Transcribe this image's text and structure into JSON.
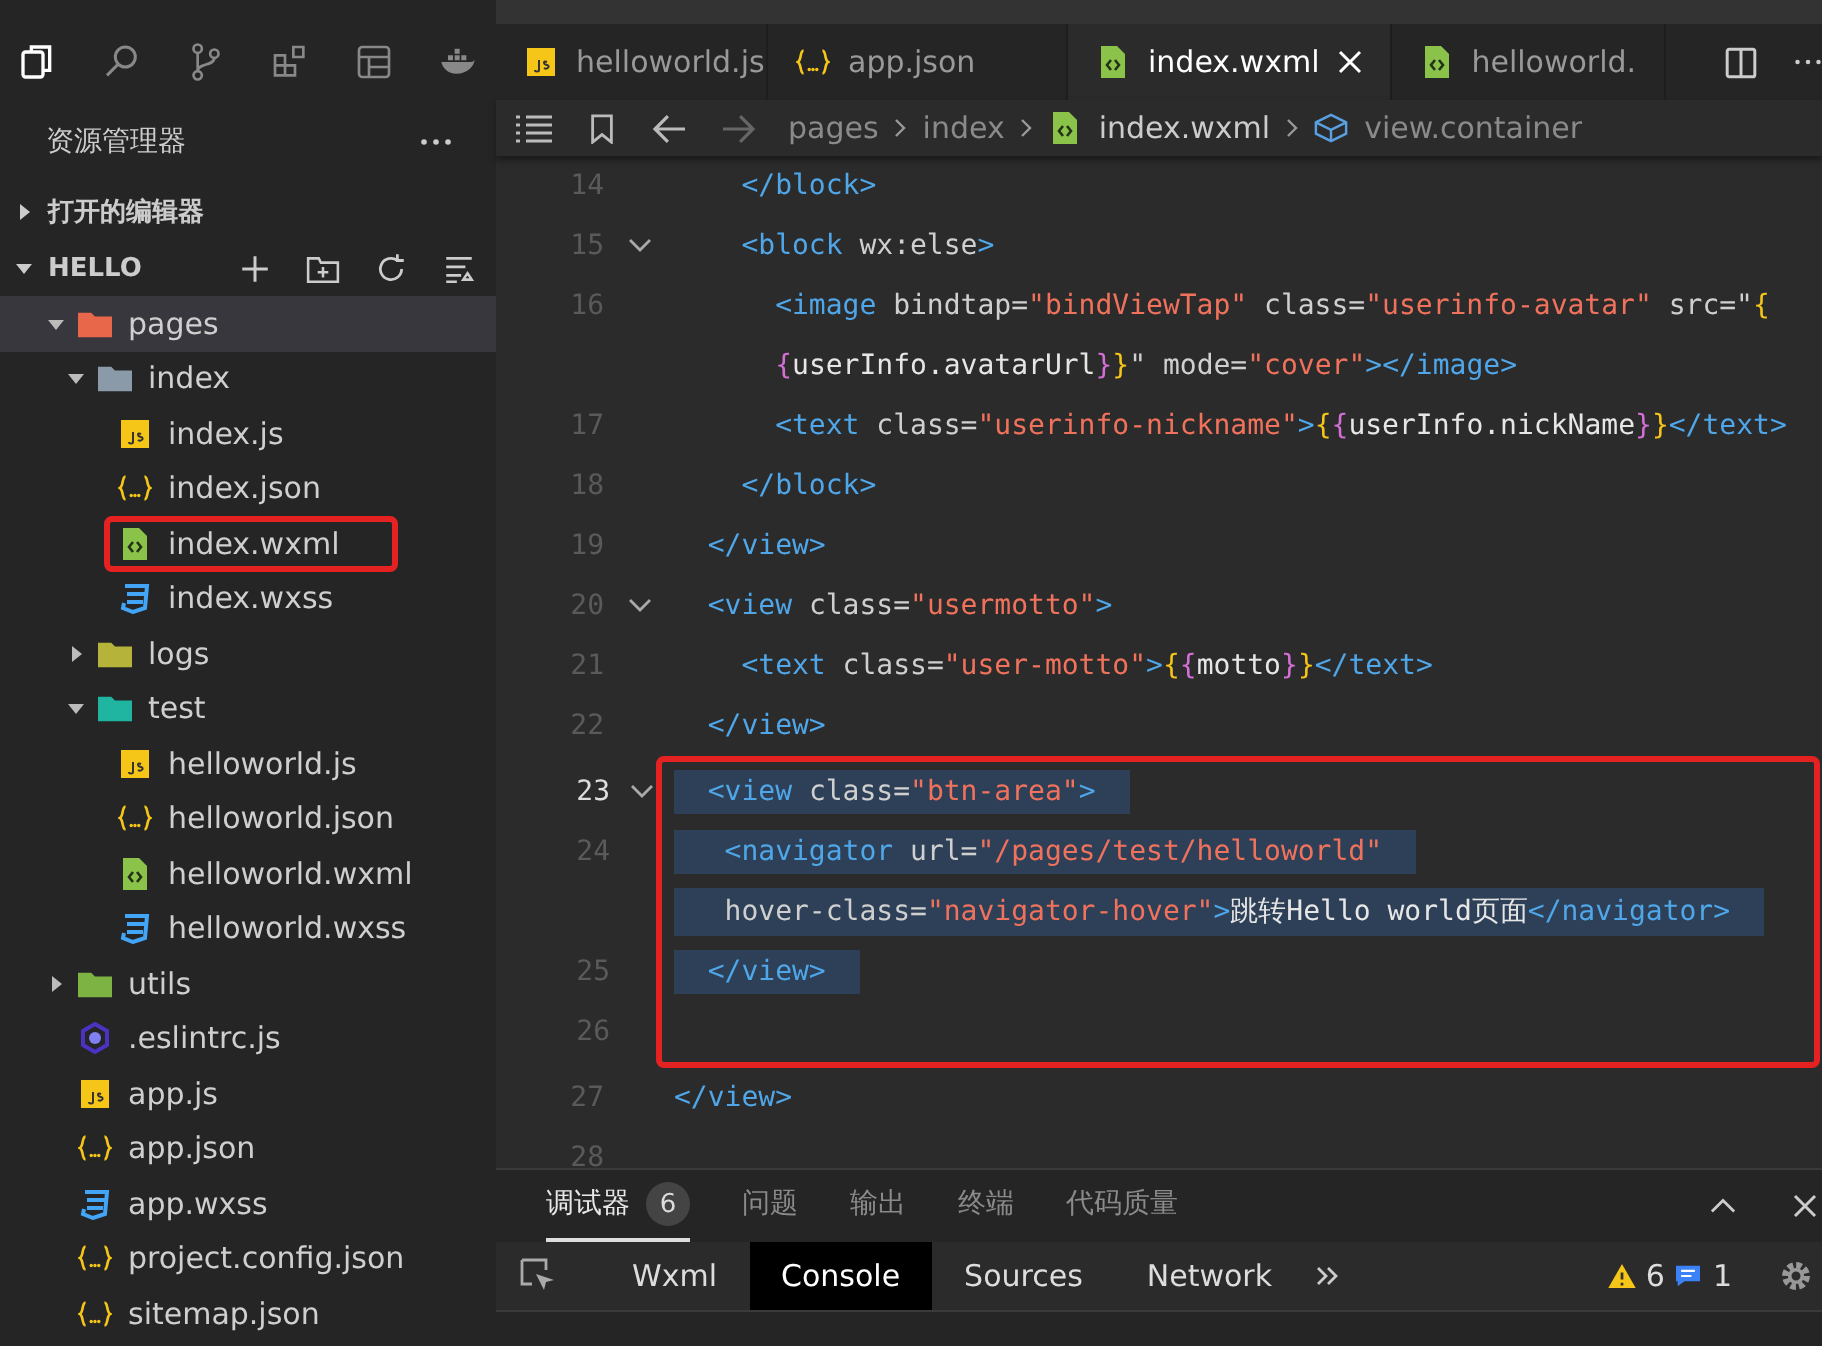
{
  "sidebar": {
    "title": "资源管理器",
    "sections": [
      {
        "label": "打开的编辑器",
        "expanded": false
      },
      {
        "label": "HELLO",
        "expanded": true
      }
    ],
    "tree": [
      {
        "name": "pages",
        "kind": "folder-pages",
        "expanded": true,
        "selected": true,
        "annotated": false,
        "children": [
          {
            "name": "index",
            "kind": "folder",
            "expanded": true,
            "selected": false,
            "annotated": false,
            "children": [
              {
                "name": "index.js",
                "kind": "js",
                "selected": false,
                "annotated": false
              },
              {
                "name": "index.json",
                "kind": "json",
                "selected": false,
                "annotated": false
              },
              {
                "name": "index.wxml",
                "kind": "wxml",
                "selected": false,
                "annotated": true
              },
              {
                "name": "index.wxss",
                "kind": "wxss",
                "selected": false,
                "annotated": false
              }
            ]
          },
          {
            "name": "logs",
            "kind": "folder-logs",
            "expanded": false,
            "selected": false,
            "annotated": false
          },
          {
            "name": "test",
            "kind": "folder-test",
            "expanded": true,
            "selected": false,
            "annotated": false,
            "children": [
              {
                "name": "helloworld.js",
                "kind": "js",
                "selected": false,
                "annotated": false
              },
              {
                "name": "helloworld.json",
                "kind": "json",
                "selected": false,
                "annotated": false
              },
              {
                "name": "helloworld.wxml",
                "kind": "wxml",
                "selected": false,
                "annotated": false
              },
              {
                "name": "helloworld.wxss",
                "kind": "wxss",
                "selected": false,
                "annotated": false
              }
            ]
          }
        ]
      },
      {
        "name": "utils",
        "kind": "folder-utils",
        "expanded": false,
        "selected": false,
        "annotated": false
      },
      {
        "name": ".eslintrc.js",
        "kind": "eslint",
        "selected": false,
        "annotated": false
      },
      {
        "name": "app.js",
        "kind": "js",
        "selected": false,
        "annotated": false
      },
      {
        "name": "app.json",
        "kind": "json",
        "selected": false,
        "annotated": false
      },
      {
        "name": "app.wxss",
        "kind": "wxss",
        "selected": false,
        "annotated": false
      },
      {
        "name": "project.config.json",
        "kind": "json",
        "selected": false,
        "annotated": false
      },
      {
        "name": "sitemap.json",
        "kind": "json",
        "selected": false,
        "annotated": false
      }
    ]
  },
  "editor": {
    "tabs": [
      {
        "label": "helloworld.js",
        "kind": "js",
        "selected": false
      },
      {
        "label": "app.json",
        "kind": "json",
        "selected": false
      },
      {
        "label": "index.wxml",
        "kind": "wxml",
        "selected": true
      },
      {
        "label": "helloworld.",
        "kind": "wxml",
        "selected": false
      }
    ],
    "breadcrumb": [
      {
        "label": "pages",
        "kind": "text"
      },
      {
        "label": "index",
        "kind": "text"
      },
      {
        "label": "index.wxml",
        "kind": "wxml"
      },
      {
        "label": "view.container",
        "kind": "element"
      }
    ],
    "sections": [
      {
        "annotated": false,
        "lines": [
          {
            "number": "14",
            "fold": false,
            "selection": false,
            "tokens": [
              {
                "kind": "tag",
                "t": "    </block>"
              }
            ]
          },
          {
            "number": "15",
            "fold": true,
            "selection": false,
            "tokens": [
              {
                "kind": "tag",
                "t": "    <block "
              },
              {
                "kind": "attr",
                "t": "wx:else"
              },
              {
                "kind": "tag",
                "t": ">"
              }
            ]
          },
          {
            "number": "16",
            "fold": false,
            "selection": false,
            "tokens": [
              {
                "kind": "tag",
                "t": "      <image "
              },
              {
                "kind": "attr",
                "t": "bindtap="
              },
              {
                "kind": "str",
                "t": "\"bindViewTap\""
              },
              {
                "kind": "attr",
                "t": " class="
              },
              {
                "kind": "str",
                "t": "\"userinfo-avatar\""
              },
              {
                "kind": "attr",
                "t": " src=\""
              },
              {
                "kind": "b1",
                "t": "{"
              }
            ]
          },
          {
            "fold": false,
            "selection": false,
            "tokens": [
              {
                "kind": "b2",
                "t": "      {"
              },
              {
                "kind": "txt",
                "t": "userInfo.avatarUrl"
              },
              {
                "kind": "b2",
                "t": "}"
              },
              {
                "kind": "b1",
                "t": "}"
              },
              {
                "kind": "attr",
                "t": "\" mode="
              },
              {
                "kind": "str",
                "t": "\"cover\""
              },
              {
                "kind": "tag",
                "t": "></image>"
              }
            ]
          },
          {
            "number": "17",
            "fold": false,
            "selection": false,
            "tokens": [
              {
                "kind": "tag",
                "t": "      <text "
              },
              {
                "kind": "attr",
                "t": "class="
              },
              {
                "kind": "str",
                "t": "\"userinfo-nickname\""
              },
              {
                "kind": "tag",
                "t": ">"
              },
              {
                "kind": "b1",
                "t": "{"
              },
              {
                "kind": "b2",
                "t": "{"
              },
              {
                "kind": "txt",
                "t": "userInfo.nickName"
              },
              {
                "kind": "b2",
                "t": "}"
              },
              {
                "kind": "b1",
                "t": "}"
              },
              {
                "kind": "tag",
                "t": "</text>"
              }
            ]
          },
          {
            "number": "18",
            "fold": false,
            "selection": false,
            "tokens": [
              {
                "kind": "tag",
                "t": "    </block>"
              }
            ]
          },
          {
            "number": "19",
            "fold": false,
            "selection": false,
            "tokens": [
              {
                "kind": "tag",
                "t": "  </view>"
              }
            ]
          },
          {
            "number": "20",
            "fold": true,
            "selection": false,
            "tokens": [
              {
                "kind": "tag",
                "t": "  <view "
              },
              {
                "kind": "attr",
                "t": "class="
              },
              {
                "kind": "str",
                "t": "\"usermotto\""
              },
              {
                "kind": "tag",
                "t": ">"
              }
            ]
          },
          {
            "number": "21",
            "fold": false,
            "selection": false,
            "tokens": [
              {
                "kind": "tag",
                "t": "    <text "
              },
              {
                "kind": "attr",
                "t": "class="
              },
              {
                "kind": "str",
                "t": "\"user-motto\""
              },
              {
                "kind": "tag",
                "t": ">"
              },
              {
                "kind": "b1",
                "t": "{"
              },
              {
                "kind": "b2",
                "t": "{"
              },
              {
                "kind": "txt",
                "t": "motto"
              },
              {
                "kind": "b2",
                "t": "}"
              },
              {
                "kind": "b1",
                "t": "}"
              },
              {
                "kind": "tag",
                "t": "</text>"
              }
            ]
          },
          {
            "number": "22",
            "fold": false,
            "current": false,
            "selection": false,
            "tokens": [
              {
                "kind": "tag",
                "t": "  </view>"
              }
            ]
          }
        ]
      },
      {
        "annotated": true,
        "lines": [
          {
            "number": "23",
            "fold": true,
            "current": true,
            "selection": true,
            "tokens": [
              {
                "kind": "tag",
                "t": "  <view "
              },
              {
                "kind": "attr",
                "t": "class="
              },
              {
                "kind": "str",
                "t": "\"btn-area\""
              },
              {
                "kind": "tag",
                "t": ">  "
              }
            ]
          },
          {
            "number": "24",
            "fold": false,
            "current": false,
            "selection": true,
            "tokens": [
              {
                "kind": "tag",
                "t": "   <navigator "
              },
              {
                "kind": "attr",
                "t": "url="
              },
              {
                "kind": "str",
                "t": "\"/pages/test/helloworld\"  "
              }
            ]
          },
          {
            "fold": false,
            "selection": true,
            "tokens": [
              {
                "kind": "attr",
                "t": "   hover-class="
              },
              {
                "kind": "str",
                "t": "\"navigator-hover\""
              },
              {
                "kind": "tag",
                "t": ">"
              },
              {
                "kind": "txt",
                "t": "跳转Hello world页面"
              },
              {
                "kind": "tag",
                "t": "</navigator>  "
              }
            ]
          },
          {
            "number": "25",
            "fold": false,
            "selection": true,
            "tokens": [
              {
                "kind": "tag",
                "t": "  </view>  "
              }
            ]
          },
          {
            "number": "26",
            "fold": false
          }
        ]
      },
      {
        "annotated": false,
        "lines": [
          {
            "number": "27",
            "fold": false,
            "selection": false,
            "tokens": [
              {
                "kind": "tag",
                "t": "</view>"
              }
            ]
          },
          {
            "number": "28",
            "fold": false
          }
        ]
      }
    ]
  },
  "panel": {
    "tabs": [
      {
        "label": "调试器",
        "badge": "6",
        "selected": true
      },
      {
        "label": "问题",
        "selected": false
      },
      {
        "label": "输出",
        "selected": false
      },
      {
        "label": "终端",
        "selected": false
      },
      {
        "label": "代码质量",
        "selected": false
      }
    ],
    "devtools_tabs": [
      {
        "label": "Wxml",
        "selected": false
      },
      {
        "label": "Console",
        "selected": true
      },
      {
        "label": "Sources",
        "selected": false
      },
      {
        "label": "Network",
        "selected": false
      }
    ],
    "warnings": "6",
    "messages": "1"
  }
}
